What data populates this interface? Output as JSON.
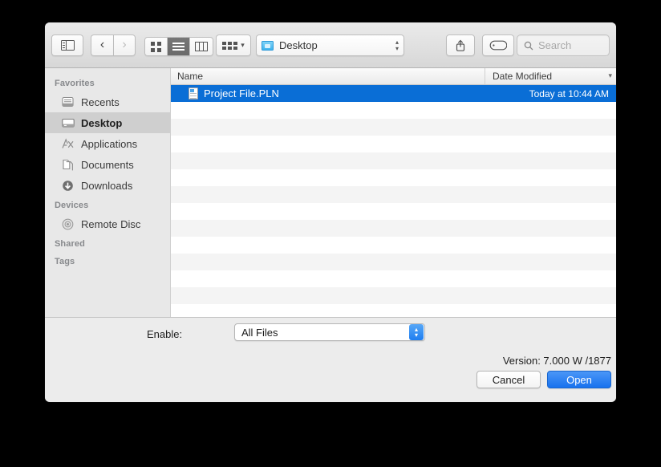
{
  "toolbar": {
    "sidebar_toggle": "sidebar-toggle",
    "back": "‹",
    "forward": "›",
    "view_icon": "icon-view",
    "view_list": "list-view",
    "view_column": "column-view",
    "arrange": "arrange-by",
    "path_label": "Desktop",
    "share": "share",
    "tag": "tag",
    "search_placeholder": "Search"
  },
  "sidebar": {
    "groups": [
      {
        "title": "Favorites",
        "items": [
          {
            "label": "Recents",
            "icon": "recents-icon",
            "selected": false
          },
          {
            "label": "Desktop",
            "icon": "desktop-icon",
            "selected": true
          },
          {
            "label": "Applications",
            "icon": "applications-icon",
            "selected": false
          },
          {
            "label": "Documents",
            "icon": "documents-icon",
            "selected": false
          },
          {
            "label": "Downloads",
            "icon": "downloads-icon",
            "selected": false
          }
        ]
      },
      {
        "title": "Devices",
        "items": [
          {
            "label": "Remote Disc",
            "icon": "remote-disc-icon",
            "selected": false
          }
        ]
      },
      {
        "title": "Shared",
        "items": []
      },
      {
        "title": "Tags",
        "items": []
      }
    ]
  },
  "filelist": {
    "columns": {
      "name": "Name",
      "date_modified": "Date Modified"
    },
    "rows": [
      {
        "name": "Project File.PLN",
        "date": "Today at 10:44 AM",
        "selected": true
      }
    ]
  },
  "bottom": {
    "enable_label": "Enable:",
    "enable_value": "All Files",
    "version": "Version: 7.000 W /1877",
    "cancel_label": "Cancel",
    "open_label": "Open"
  },
  "colors": {
    "selection_blue": "#0a6ed6",
    "default_button_blue": "#1872ee",
    "sidebar_bg": "#e8e8e8",
    "panel_bg": "#ececec",
    "row_alt": "#f4f4f4"
  }
}
